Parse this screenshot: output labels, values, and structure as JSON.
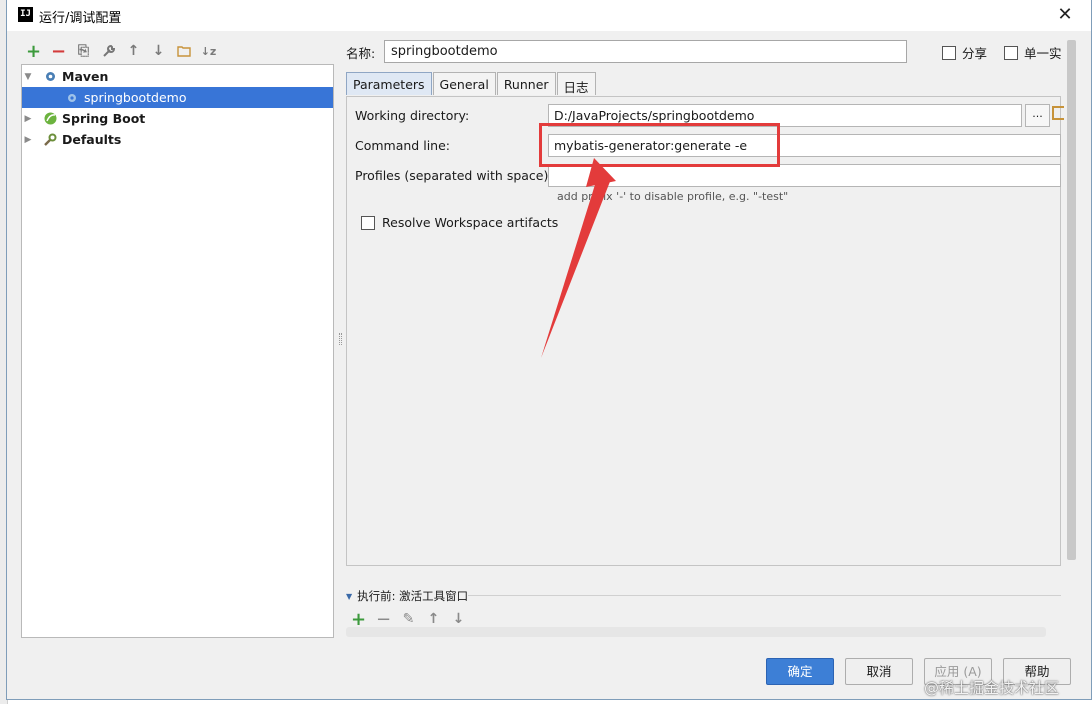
{
  "window": {
    "title": "运行/调试配置",
    "close_glyph": "✕"
  },
  "toolbar": {
    "add_glyph": "+",
    "remove_glyph": "−",
    "copy_glyph": "⎘",
    "edit_glyph": "🔧",
    "up_glyph": "↑",
    "down_glyph": "↓",
    "folder_glyph": "▭",
    "sort_glyph": "↓z"
  },
  "tree": {
    "maven": {
      "label": "Maven",
      "expanded_glyph": "▼",
      "icon": "gear-icon"
    },
    "springbootdemo": {
      "label": "springbootdemo",
      "icon": "gear-icon"
    },
    "spring_boot": {
      "label": "Spring Boot",
      "collapsed_glyph": "▶",
      "icon": "spring-leaf-icon"
    },
    "defaults": {
      "label": "Defaults",
      "collapsed_glyph": "▶",
      "icon": "wrench-icon"
    }
  },
  "name_field": {
    "label": "名称:",
    "value": "springbootdemo"
  },
  "options": {
    "share": "分享",
    "single_instance": "单一实"
  },
  "tabs": [
    {
      "label": "Parameters"
    },
    {
      "label": "General"
    },
    {
      "label": "Runner"
    },
    {
      "label": "日志"
    }
  ],
  "params": {
    "working_dir": {
      "label": "Working directory:",
      "value": "D:/JavaProjects/springbootdemo",
      "browse": "..."
    },
    "command_line": {
      "label": "Command line:",
      "value": "mybatis-generator:generate -e"
    },
    "profiles": {
      "label": "Profiles (separated with space):",
      "value": "",
      "hint": "add prefix '-' to disable profile, e.g. \"-test\""
    },
    "resolve_workspace": {
      "label": "Resolve Workspace artifacts"
    }
  },
  "before_launch": {
    "label": "执行前: 激活工具窗口",
    "add_glyph": "+",
    "remove_glyph": "−",
    "edit_glyph": "✎",
    "up_glyph": "↑",
    "down_glyph": "↓"
  },
  "buttons": {
    "ok": "确定",
    "cancel": "取消",
    "apply": "应用 (A)",
    "help": "帮助"
  },
  "watermark": "@稀土掘金技术社区",
  "colors": {
    "selection": "#3875d7",
    "primary_button": "#3d7fd6",
    "annotation_red": "#e33b3b"
  }
}
